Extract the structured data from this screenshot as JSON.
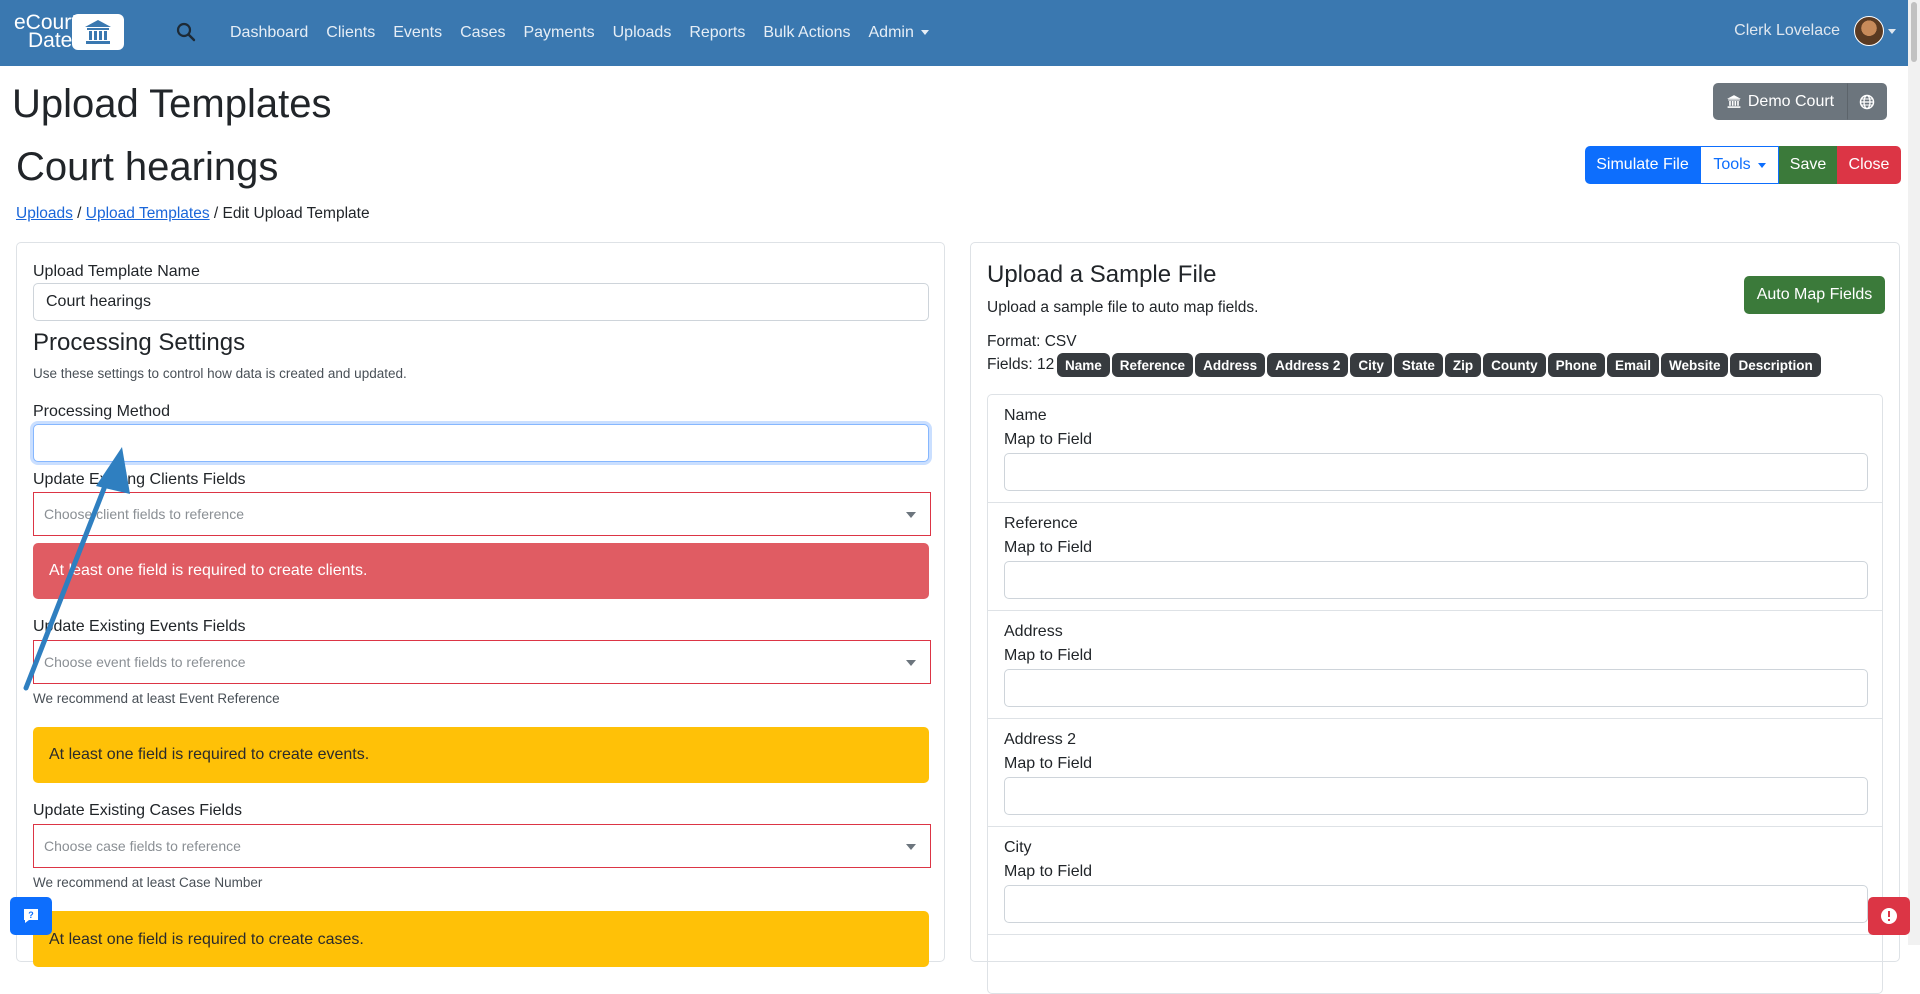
{
  "navbar": {
    "brand_line1": "eCourt",
    "brand_line2": "Date",
    "links": [
      "Dashboard",
      "Clients",
      "Events",
      "Cases",
      "Payments",
      "Uploads",
      "Reports",
      "Bulk Actions",
      "Admin"
    ],
    "user_name": "Clerk Lovelace"
  },
  "page": {
    "title": "Upload Templates",
    "subtitle": "Court hearings",
    "breadcrumb": {
      "uploads": "Uploads",
      "sep1": " / ",
      "templates": "Upload Templates",
      "sep2": " / ",
      "current": "Edit Upload Template"
    }
  },
  "court_button": "Demo Court",
  "actions": {
    "simulate": "Simulate File",
    "tools": "Tools",
    "save": "Save",
    "close": "Close"
  },
  "left": {
    "template_name_label": "Upload Template Name",
    "template_name_value": "Court hearings",
    "processing_title": "Processing Settings",
    "processing_help": "Use these settings to control how data is created and updated.",
    "processing_method_label": "Processing Method",
    "processing_method_value": "",
    "clients_label": "Update Existing Clients Fields",
    "clients_placeholder": "Choose client fields to reference",
    "clients_alert": "At least one field is required to create clients.",
    "events_label": "Update Existing Events Fields",
    "events_placeholder": "Choose event fields to reference",
    "events_help": "We recommend at least Event Reference",
    "events_alert": "At least one field is required to create events.",
    "cases_label": "Update Existing Cases Fields",
    "cases_placeholder": "Choose case fields to reference",
    "cases_help": "We recommend at least Case Number",
    "cases_alert": "At least one field is required to create cases."
  },
  "right": {
    "title": "Upload a Sample File",
    "help": "Upload a sample file to auto map fields.",
    "auto_map": "Auto Map Fields",
    "format": "Format: CSV",
    "fields_count": "Fields: 12",
    "field_badges": [
      "Name",
      "Reference",
      "Address",
      "Address 2",
      "City",
      "State",
      "Zip",
      "County",
      "Phone",
      "Email",
      "Website",
      "Description"
    ],
    "map_to_label": "Map to Field",
    "mappings": [
      {
        "name": "Name",
        "value": ""
      },
      {
        "name": "Reference",
        "value": ""
      },
      {
        "name": "Address",
        "value": ""
      },
      {
        "name": "Address 2",
        "value": ""
      },
      {
        "name": "City",
        "value": ""
      }
    ]
  },
  "colors": {
    "navbar": "#3a78b0",
    "primary": "#0d6efd",
    "success": "#3b7a3a",
    "danger": "#dc3545",
    "warning": "#ffc107",
    "annotation_arrow": "#2f7fc0"
  },
  "icons": {
    "search": "search-icon",
    "brand": "courthouse-icon",
    "court": "courthouse-icon",
    "globe": "globe-icon",
    "chat": "chat-icon",
    "error": "alert-icon"
  }
}
